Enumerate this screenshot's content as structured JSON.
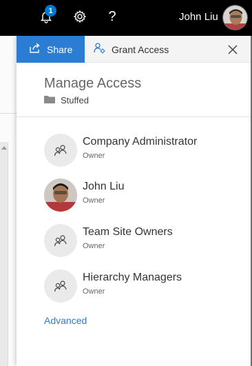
{
  "topbar": {
    "notification_count": "1",
    "help_glyph": "?",
    "user_name": "John Liu",
    "icons": [
      "bell-icon",
      "gear-icon",
      "help-icon"
    ]
  },
  "panel": {
    "tabs": [
      {
        "label": "Share",
        "icon": "share-icon",
        "selected": true
      },
      {
        "label": "Grant Access",
        "icon": "grant-access-icon",
        "selected": false
      }
    ],
    "title": "Manage Access",
    "folder_name": "Stuffed",
    "people": [
      {
        "name": "Company Administrator",
        "role": "Owner",
        "avatar": "group-icon"
      },
      {
        "name": "John Liu",
        "role": "Owner",
        "avatar": "photo"
      },
      {
        "name": "Team Site Owners",
        "role": "Owner",
        "avatar": "group-icon"
      },
      {
        "name": "Hierarchy Managers",
        "role": "Owner",
        "avatar": "group-icon"
      }
    ],
    "advanced_link": "Advanced"
  },
  "colors": {
    "accent": "#2b7cd3",
    "topbar_bg": "#000000",
    "badge": "#0078d4"
  }
}
